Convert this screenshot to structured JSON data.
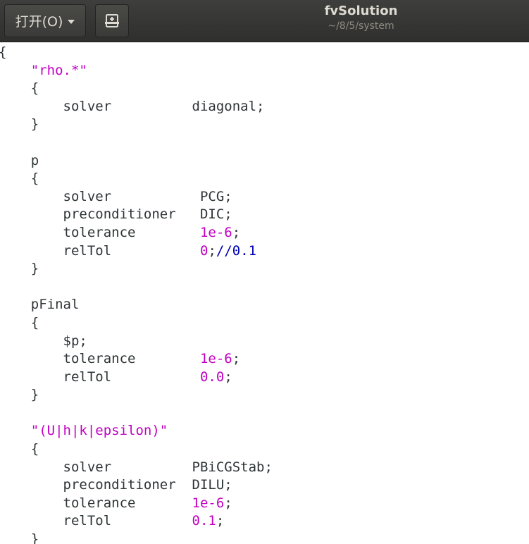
{
  "header": {
    "open_label": "打开(O)",
    "title": "fvSolution",
    "subtitle": "~/8/5/system"
  },
  "icons": {
    "open_menu": "chevron-down-icon",
    "save": "save-document-icon"
  },
  "colors": {
    "titlebar": "#353533",
    "string": "#c200c2",
    "number": "#c200c2",
    "comment": "#0000b3",
    "text": "#2e3436"
  },
  "code_lines": [
    [
      {
        "t": "{",
        "c": "plain"
      }
    ],
    [
      {
        "t": "    ",
        "c": "plain"
      },
      {
        "t": "\"rho.*\"",
        "c": "str"
      }
    ],
    [
      {
        "t": "    {",
        "c": "plain"
      }
    ],
    [
      {
        "t": "        solver          diagonal;",
        "c": "plain"
      }
    ],
    [
      {
        "t": "    }",
        "c": "plain"
      }
    ],
    [
      {
        "t": "",
        "c": "plain"
      }
    ],
    [
      {
        "t": "    p",
        "c": "plain"
      }
    ],
    [
      {
        "t": "    {",
        "c": "plain"
      }
    ],
    [
      {
        "t": "        solver           PCG;",
        "c": "plain"
      }
    ],
    [
      {
        "t": "        preconditioner   DIC;",
        "c": "plain"
      }
    ],
    [
      {
        "t": "        tolerance        ",
        "c": "plain"
      },
      {
        "t": "1e-6",
        "c": "num"
      },
      {
        "t": ";",
        "c": "plain"
      }
    ],
    [
      {
        "t": "        relTol           ",
        "c": "plain"
      },
      {
        "t": "0",
        "c": "num"
      },
      {
        "t": ";",
        "c": "plain"
      },
      {
        "t": "//0.1",
        "c": "cmt"
      }
    ],
    [
      {
        "t": "    }",
        "c": "plain"
      }
    ],
    [
      {
        "t": "",
        "c": "plain"
      }
    ],
    [
      {
        "t": "    pFinal",
        "c": "plain"
      }
    ],
    [
      {
        "t": "    {",
        "c": "plain"
      }
    ],
    [
      {
        "t": "        $p;",
        "c": "plain"
      }
    ],
    [
      {
        "t": "        tolerance        ",
        "c": "plain"
      },
      {
        "t": "1e-6",
        "c": "num"
      },
      {
        "t": ";",
        "c": "plain"
      }
    ],
    [
      {
        "t": "        relTol           ",
        "c": "plain"
      },
      {
        "t": "0.0",
        "c": "num"
      },
      {
        "t": ";",
        "c": "plain"
      }
    ],
    [
      {
        "t": "    }",
        "c": "plain"
      }
    ],
    [
      {
        "t": "",
        "c": "plain"
      }
    ],
    [
      {
        "t": "    ",
        "c": "plain"
      },
      {
        "t": "\"(U|h|k|epsilon)\"",
        "c": "str"
      }
    ],
    [
      {
        "t": "    {",
        "c": "plain"
      }
    ],
    [
      {
        "t": "        solver          PBiCGStab;",
        "c": "plain"
      }
    ],
    [
      {
        "t": "        preconditioner  DILU;",
        "c": "plain"
      }
    ],
    [
      {
        "t": "        tolerance       ",
        "c": "plain"
      },
      {
        "t": "1e-6",
        "c": "num"
      },
      {
        "t": ";",
        "c": "plain"
      }
    ],
    [
      {
        "t": "        relTol          ",
        "c": "plain"
      },
      {
        "t": "0.1",
        "c": "num"
      },
      {
        "t": ";",
        "c": "plain"
      }
    ],
    [
      {
        "t": "    }",
        "c": "plain"
      }
    ]
  ]
}
